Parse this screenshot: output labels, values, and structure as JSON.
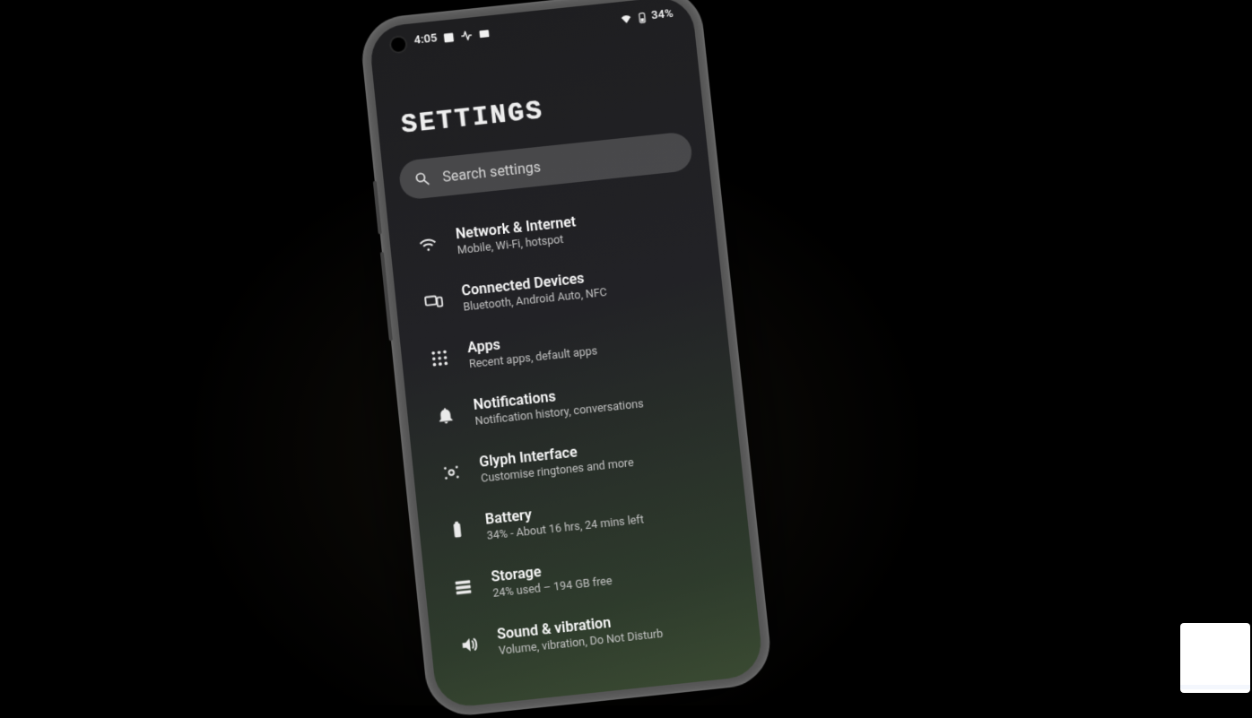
{
  "statusbar": {
    "time": "4:05",
    "battery_text": "34%",
    "icons_left": [
      "calendar-icon",
      "activity-icon",
      "picture-icon"
    ],
    "icons_right": [
      "wifi-icon",
      "battery-icon"
    ]
  },
  "page": {
    "title": "SETTINGS"
  },
  "search": {
    "placeholder": "Search settings"
  },
  "settings": [
    {
      "icon": "wifi-icon",
      "title": "Network & Internet",
      "subtitle": "Mobile, Wi-Fi, hotspot"
    },
    {
      "icon": "devices-icon",
      "title": "Connected Devices",
      "subtitle": "Bluetooth, Android Auto, NFC"
    },
    {
      "icon": "apps-icon",
      "title": "Apps",
      "subtitle": "Recent apps, default apps"
    },
    {
      "icon": "bell-icon",
      "title": "Notifications",
      "subtitle": "Notification history, conversations"
    },
    {
      "icon": "glyph-icon",
      "title": "Glyph Interface",
      "subtitle": "Customise ringtones and more"
    },
    {
      "icon": "battery-icon",
      "title": "Battery",
      "subtitle": "34% - About 16 hrs, 24 mins left"
    },
    {
      "icon": "storage-icon",
      "title": "Storage",
      "subtitle": "24% used – 194 GB free"
    },
    {
      "icon": "volume-icon",
      "title": "Sound & vibration",
      "subtitle": "Volume, vibration, Do Not Disturb"
    }
  ]
}
